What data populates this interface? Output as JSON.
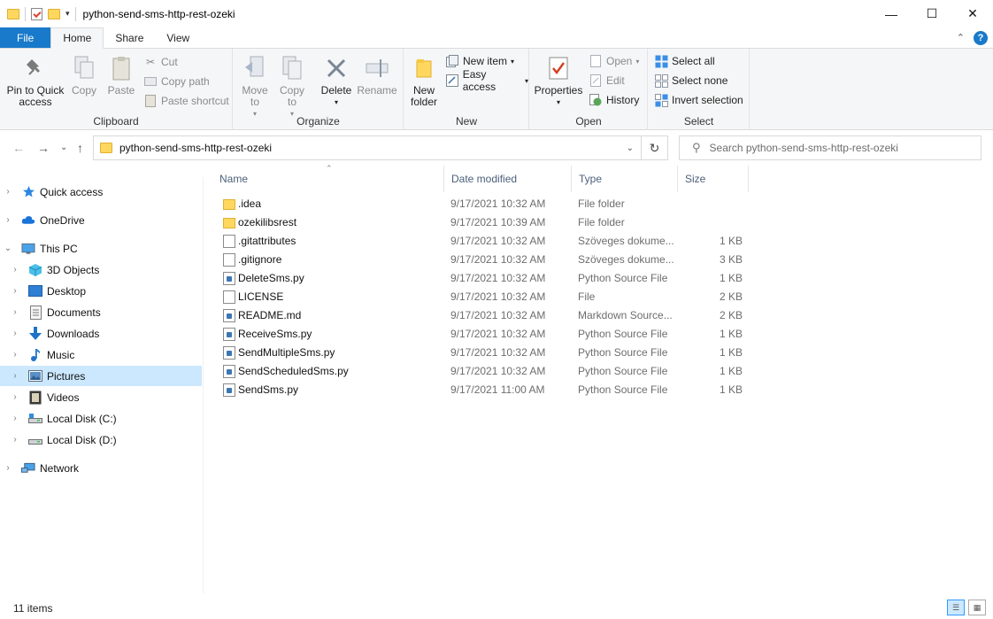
{
  "window": {
    "title": "python-send-sms-http-rest-ozeki",
    "minimize": "—",
    "maximize": "☐",
    "close": "✕"
  },
  "ribbon_tabs": [
    "File",
    "Home",
    "Share",
    "View"
  ],
  "ribbon": {
    "clipboard": {
      "label": "Clipboard",
      "pin": "Pin to Quick access",
      "copy": "Copy",
      "paste": "Paste",
      "cut": "Cut",
      "copy_path": "Copy path",
      "paste_shortcut": "Paste shortcut"
    },
    "organize": {
      "label": "Organize",
      "move_to": "Move to",
      "copy_to": "Copy to",
      "delete": "Delete",
      "rename": "Rename"
    },
    "new": {
      "label": "New",
      "new_folder": "New folder",
      "new_item": "New item",
      "easy_access": "Easy access"
    },
    "open": {
      "label": "Open",
      "properties": "Properties",
      "open": "Open",
      "edit": "Edit",
      "history": "History"
    },
    "select": {
      "label": "Select",
      "select_all": "Select all",
      "select_none": "Select none",
      "invert": "Invert selection"
    }
  },
  "address": {
    "path": "python-send-sms-http-rest-ozeki",
    "search_placeholder": "Search python-send-sms-http-rest-ozeki"
  },
  "nav": [
    {
      "label": "Quick access",
      "icon": "star-icon"
    },
    {
      "label": "OneDrive",
      "icon": "cloud-icon"
    },
    {
      "label": "This PC",
      "icon": "pc-icon"
    },
    {
      "label": "3D Objects",
      "icon": "cube-icon"
    },
    {
      "label": "Desktop",
      "icon": "desktop-icon"
    },
    {
      "label": "Documents",
      "icon": "documents-icon"
    },
    {
      "label": "Downloads",
      "icon": "download-icon"
    },
    {
      "label": "Music",
      "icon": "music-icon"
    },
    {
      "label": "Pictures",
      "icon": "pictures-icon"
    },
    {
      "label": "Videos",
      "icon": "videos-icon"
    },
    {
      "label": "Local Disk (C:)",
      "icon": "disk-icon"
    },
    {
      "label": "Local Disk (D:)",
      "icon": "disk-icon"
    },
    {
      "label": "Network",
      "icon": "network-icon"
    }
  ],
  "columns": [
    "Name",
    "Date modified",
    "Type",
    "Size"
  ],
  "files": [
    {
      "name": ".idea",
      "date": "9/17/2021 10:32 AM",
      "type": "File folder",
      "size": "",
      "kind": "folder"
    },
    {
      "name": "ozekilibsrest",
      "date": "9/17/2021 10:39 AM",
      "type": "File folder",
      "size": "",
      "kind": "folder"
    },
    {
      "name": ".gitattributes",
      "date": "9/17/2021 10:32 AM",
      "type": "Szöveges dokume...",
      "size": "1 KB",
      "kind": "doc"
    },
    {
      "name": ".gitignore",
      "date": "9/17/2021 10:32 AM",
      "type": "Szöveges dokume...",
      "size": "3 KB",
      "kind": "doc"
    },
    {
      "name": "DeleteSms.py",
      "date": "9/17/2021 10:32 AM",
      "type": "Python Source File",
      "size": "1 KB",
      "kind": "py"
    },
    {
      "name": "LICENSE",
      "date": "9/17/2021 10:32 AM",
      "type": "File",
      "size": "2 KB",
      "kind": "doc"
    },
    {
      "name": "README.md",
      "date": "9/17/2021 10:32 AM",
      "type": "Markdown Source...",
      "size": "2 KB",
      "kind": "py"
    },
    {
      "name": "ReceiveSms.py",
      "date": "9/17/2021 10:32 AM",
      "type": "Python Source File",
      "size": "1 KB",
      "kind": "py"
    },
    {
      "name": "SendMultipleSms.py",
      "date": "9/17/2021 10:32 AM",
      "type": "Python Source File",
      "size": "1 KB",
      "kind": "py"
    },
    {
      "name": "SendScheduledSms.py",
      "date": "9/17/2021 10:32 AM",
      "type": "Python Source File",
      "size": "1 KB",
      "kind": "py"
    },
    {
      "name": "SendSms.py",
      "date": "9/17/2021 11:00 AM",
      "type": "Python Source File",
      "size": "1 KB",
      "kind": "py"
    }
  ],
  "status": {
    "count": "11 items"
  }
}
